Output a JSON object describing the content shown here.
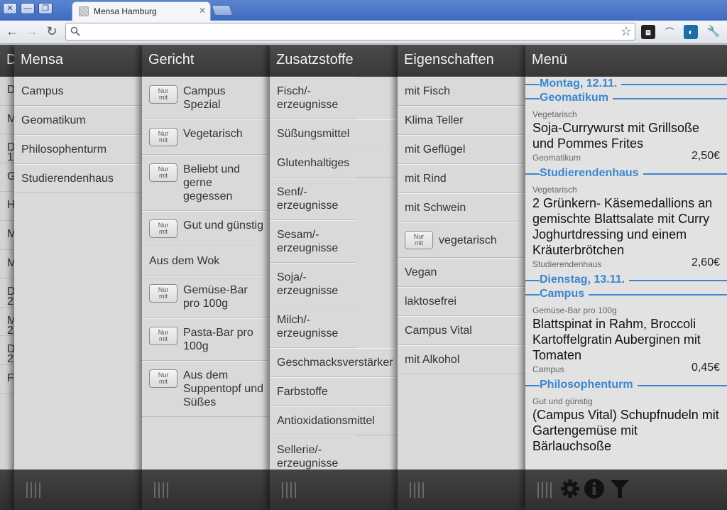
{
  "browser": {
    "tab_title": "Mensa Hamburg",
    "tab_close": "✕",
    "window_close": "✕",
    "window_minimize": "—",
    "window_restore": "❐"
  },
  "toolbar": {
    "back": "←",
    "forward": "→",
    "reload": "↻",
    "search_glyph": "⚲",
    "star": "☆",
    "url": ""
  },
  "side_strip": [
    "D",
    "M",
    "D 1",
    "G",
    "H",
    "M",
    "M",
    "D 2",
    "M 2",
    "D 2",
    "F"
  ],
  "panels": {
    "mensa": {
      "title": "Mensa",
      "items": [
        "Campus",
        "Geomatikum",
        "Philosophenturm",
        "Studierendenhaus"
      ]
    },
    "gericht": {
      "title": "Gericht",
      "badge_line1": "Nur",
      "badge_line2": "mit",
      "items": [
        {
          "label": "Campus Spezial",
          "badge": true
        },
        {
          "label": "Vegetarisch",
          "badge": true
        },
        {
          "label": "Beliebt und gerne gegessen",
          "badge": true
        },
        {
          "label": "Gut und günstig",
          "badge": true
        },
        {
          "label": "Aus dem Wok",
          "badge": false
        },
        {
          "label": "Gemüse-Bar pro 100g",
          "badge": true
        },
        {
          "label": "Pasta-Bar pro 100g",
          "badge": true
        },
        {
          "label": "Aus dem Suppentopf und Süßes",
          "badge": true
        }
      ]
    },
    "zusatzstoffe": {
      "title": "Zusatzstoffe",
      "items": [
        "Fisch/-erzeugnisse",
        "Süßungsmittel",
        "Glutenhaltiges",
        "Senf/-erzeugnisse",
        "Sesam/-erzeugnisse",
        "Soja/-erzeugnisse",
        "Milch/-erzeugnisse",
        "Geschmacksverstärker",
        "Farbstoffe",
        "Antioxidationsmittel",
        "Sellerie/-erzeugnisse"
      ]
    },
    "eigenschaften": {
      "title": "Eigenschaften",
      "items": [
        {
          "label": "mit Fisch",
          "badge": false
        },
        {
          "label": "Klima Teller",
          "badge": false
        },
        {
          "label": "mit Geflügel",
          "badge": false
        },
        {
          "label": "mit Rind",
          "badge": false
        },
        {
          "label": "mit Schwein",
          "badge": false
        },
        {
          "label": "vegetarisch",
          "badge": true
        },
        {
          "label": "Vegan",
          "badge": false
        },
        {
          "label": "laktosefrei",
          "badge": false
        },
        {
          "label": "Campus Vital",
          "badge": false
        },
        {
          "label": "mit Alkohol",
          "badge": false
        }
      ]
    },
    "menu": {
      "title": "Menü",
      "entries": [
        {
          "kind": "header",
          "text": "Montag, 12.11."
        },
        {
          "kind": "header",
          "text": "Geomatikum"
        },
        {
          "kind": "meal",
          "category": "Vegetarisch",
          "name": "Soja-Currywurst mit Grillsoße und Pommes Frites",
          "location": "Geomatikum",
          "price": "2,50€"
        },
        {
          "kind": "header",
          "text": "Studierendenhaus"
        },
        {
          "kind": "meal",
          "category": "Vegetarisch",
          "name": "2 Grünkern- Käsemedallions an gemischte Blattsalate mit Curry Joghurtdressing und einem Kräuterbrötchen",
          "location": "Studierendenhaus",
          "price": "2,60€"
        },
        {
          "kind": "header",
          "text": "Dienstag, 13.11."
        },
        {
          "kind": "header",
          "text": "Campus"
        },
        {
          "kind": "meal",
          "category": "Gemüse-Bar pro 100g",
          "name": "Blattspinat in Rahm, Broccoli Kartoffelgratin Auberginen mit Tomaten",
          "location": "Campus",
          "price": "0,45€"
        },
        {
          "kind": "header",
          "text": "Philosophenturm"
        },
        {
          "kind": "meal",
          "category": "Gut und günstig",
          "name": "(Campus Vital) Schupfnudeln mit Gartengemüse mit Bärlauchsoße",
          "location": "",
          "price": ""
        }
      ],
      "footer_icons": [
        "gear-icon",
        "info-icon",
        "filter-icon"
      ]
    }
  },
  "colors": {
    "accent": "#3b86cf",
    "header_bg": "#3f3f3f",
    "panel_bg": "#d9d9d9"
  }
}
